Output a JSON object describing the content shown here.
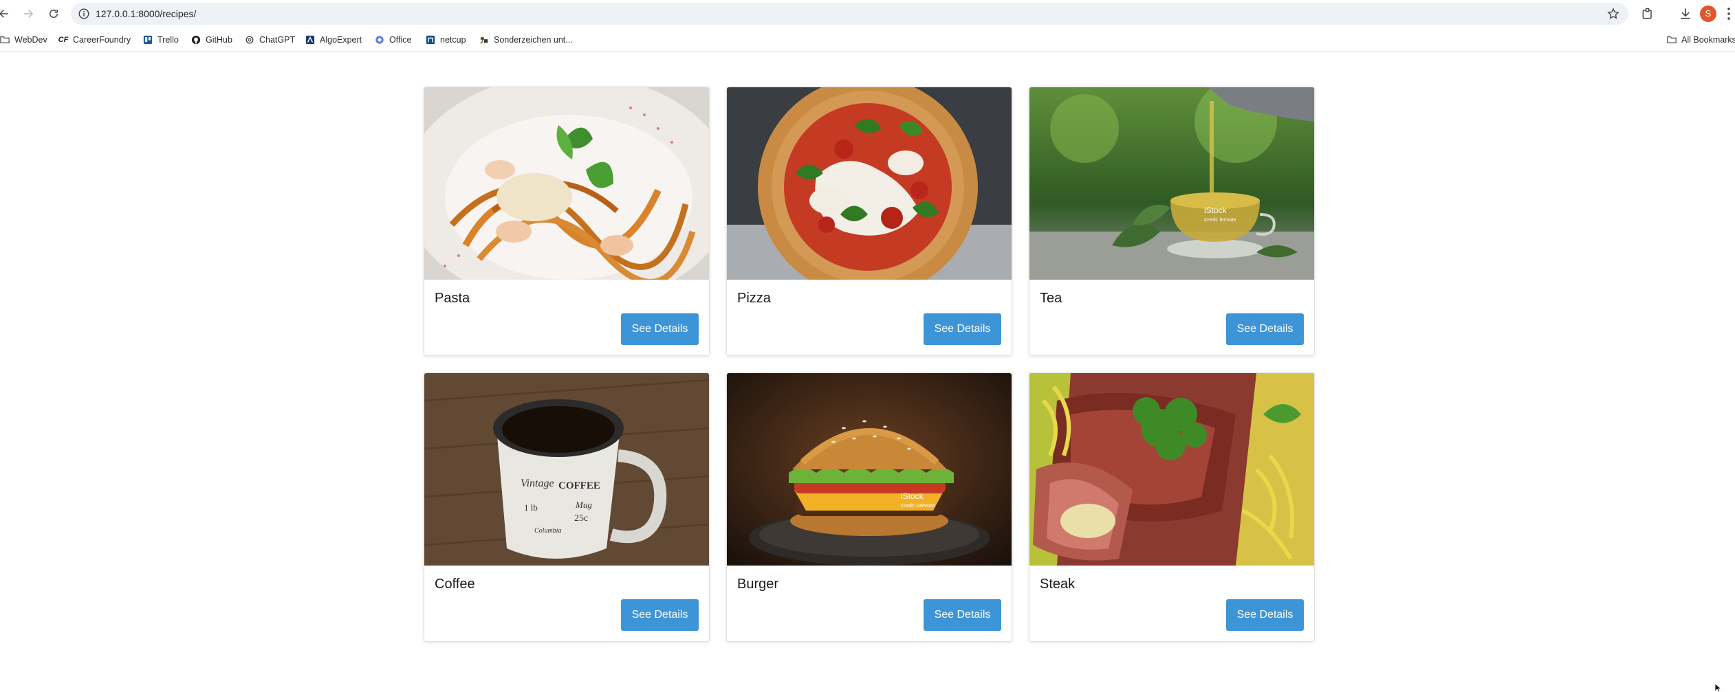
{
  "browser": {
    "url": "127.0.0.1:8000/recipes/",
    "profile_initial": "S",
    "bookmarks": [
      {
        "label": "WebDev",
        "icon": "folder-icon"
      },
      {
        "label": "CareerFoundry",
        "icon": "careerfoundry-icon"
      },
      {
        "label": "Trello",
        "icon": "trello-icon"
      },
      {
        "label": "GitHub",
        "icon": "github-icon"
      },
      {
        "label": "ChatGPT",
        "icon": "chatgpt-icon"
      },
      {
        "label": "AlgoExpert",
        "icon": "algoexpert-icon"
      },
      {
        "label": "Office",
        "icon": "office-icon"
      },
      {
        "label": "netcup",
        "icon": "netcup-icon"
      },
      {
        "label": "Sonderzeichen unt...",
        "icon": "sonderzeichen-icon"
      }
    ],
    "all_bookmarks_label": "All Bookmarks"
  },
  "recipes": [
    {
      "name": "Pasta",
      "button": "See Details",
      "image": "pasta-photo"
    },
    {
      "name": "Pizza",
      "button": "See Details",
      "image": "pizza-photo"
    },
    {
      "name": "Tea",
      "button": "See Details",
      "image": "tea-photo",
      "watermark": "iStock",
      "credit": "Credit: fermate"
    },
    {
      "name": "Coffee",
      "button": "See Details",
      "image": "coffee-photo",
      "mug_text": [
        "Vintage",
        "COFFEE",
        "1 lb",
        "Mug",
        "25c",
        "Columbia"
      ]
    },
    {
      "name": "Burger",
      "button": "See Details",
      "image": "burger-photo",
      "watermark": "iStock",
      "credit": "Credit: GMVozd"
    },
    {
      "name": "Steak",
      "button": "See Details",
      "image": "steak-photo"
    }
  ],
  "colors": {
    "button": "#3d95d7",
    "omnibox": "#eef1f6",
    "avatar": "#e0572b"
  }
}
